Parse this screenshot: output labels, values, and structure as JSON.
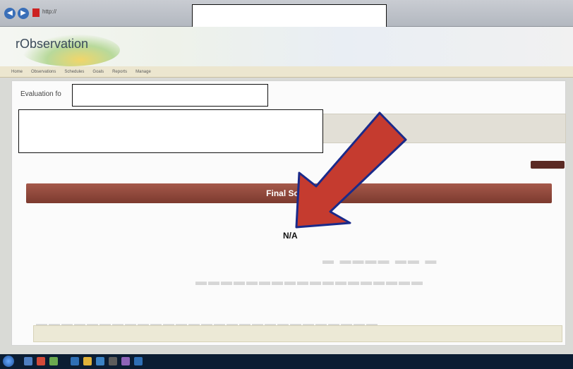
{
  "browser": {
    "url": "http://",
    "tabs_text": "rObservation",
    "back_glyph": "◀",
    "forward_glyph": "▶"
  },
  "app": {
    "title": "rObservation",
    "subtitle": "",
    "user_links": []
  },
  "menu": {
    "items": [
      "Home",
      "Observations",
      "Schedules",
      "Goals",
      "Reports",
      "Manage"
    ]
  },
  "evaluation": {
    "label": "Evaluation fo"
  },
  "buttons": {
    "top_action": ""
  },
  "score": {
    "label": "Final Score",
    "value": "N/A"
  },
  "table": {
    "columns": []
  },
  "colors": {
    "score_bar": "#8b4236",
    "arrow_fill": "#c53b2f",
    "arrow_outline": "#1a2a8a"
  },
  "icons": [
    "back-icon",
    "forward-icon",
    "favicon",
    "start-orb-icon",
    "taskbar-app-icon"
  ]
}
